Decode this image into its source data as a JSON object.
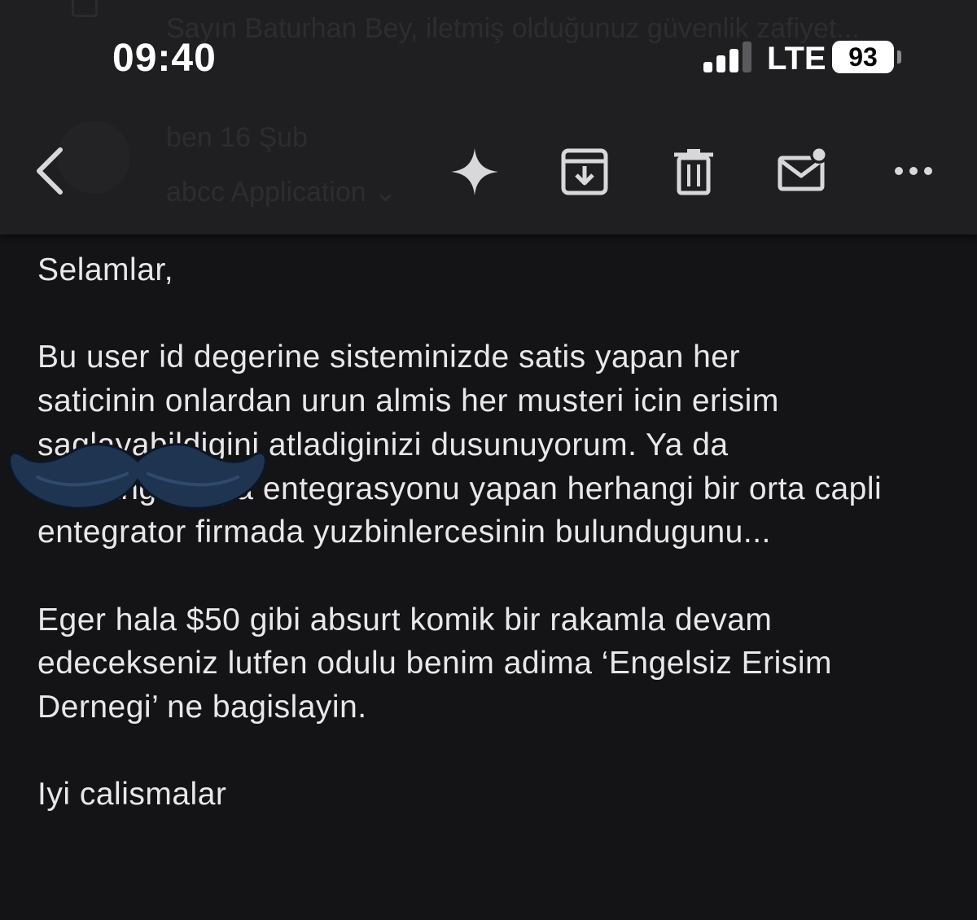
{
  "status_bar": {
    "time": "09:40",
    "network": "LTE",
    "battery_level": "93",
    "signal_bars_active": 3,
    "signal_bars_total": 4
  },
  "background_header": {
    "subject_preview": "Sayın Baturhan Bey, iletmiş olduğunuz güvenlik zafiyet...",
    "sender_line": "ben  16 Şub",
    "recipient_line": "abcc Application ⌄"
  },
  "toolbar": {
    "icons": [
      "back-icon",
      "sparkle-icon",
      "archive-icon",
      "trash-icon",
      "mail-unread-icon",
      "more-icon"
    ]
  },
  "email": {
    "greeting": "Selamlar,",
    "paragraph1": "Bu user id degerine sisteminizde satis yapan her\nsaticinin onlardan urun almis her musteri icin erisim\nsaglayabildigini atladiginizi dusunuyorum. Ya da\nherhangi bir ya entegrasyonu yapan herhangi bir orta capli\nentegrator firmada yuzbinlercesinin bulundugunu...",
    "paragraph2": "Eger hala $50 gibi absurt komik bir rakamla devam\nedecekseniz lutfen odulu benim adima ‘Engelsiz Erisim\nDernegi’ ne bagislayin.",
    "closing": "Iyi calismalar"
  },
  "colors": {
    "background": "#141416",
    "toolbar": "#1f1f21",
    "text": "#e8e8ea",
    "mustache": "#1f3450"
  }
}
